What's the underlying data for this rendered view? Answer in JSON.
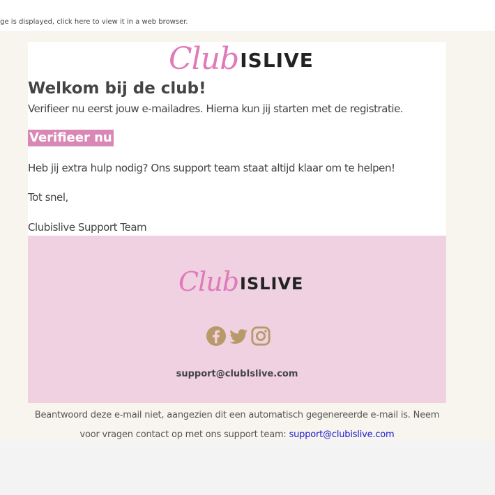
{
  "top_notice": "age is displayed, click here to view it in a web browser.",
  "logo": {
    "script": "Club",
    "bold": "ISLIVE"
  },
  "heading": "Welkom bij de club!",
  "intro": "Verifieer nu eerst jouw e-mailadres. Hierna kun jij starten met de registratie.",
  "verify_button": "Verifieer nu",
  "help": "Heb jij extra hulp nodig? Ons support team staat altijd klaar om te helpen!",
  "closing": "Tot snel,",
  "signature": "Clubislive Support Team",
  "footer": {
    "logo": {
      "script": "Club",
      "bold": "ISLIVE"
    },
    "socials": [
      "facebook-icon",
      "twitter-icon",
      "instagram-icon"
    ],
    "email": "support@clubIslive.com"
  },
  "disclaimer": {
    "line1": "Beantwoord deze e-mail niet, aangezien dit een automatisch gegenereerde e-mail is. Neem",
    "line2": "voor vragen contact op met ons support team:",
    "link": "support@clubislive.com"
  },
  "colors": {
    "brand_pink": "#e07aba",
    "button_pink": "#d987b5",
    "footer_bg": "#efd1e1",
    "icon_gold": "#b89a6a",
    "link_blue": "#1a1ad6"
  }
}
